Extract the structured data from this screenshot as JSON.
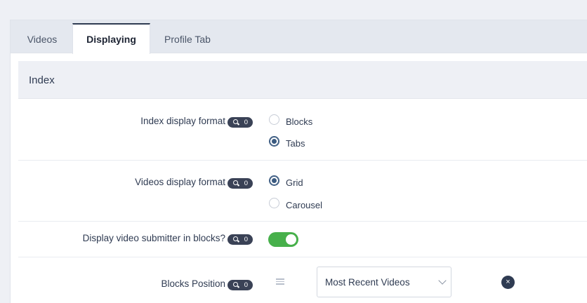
{
  "tabs": [
    {
      "label": "Videos"
    },
    {
      "label": "Displaying"
    },
    {
      "label": "Profile Tab"
    }
  ],
  "section": {
    "title": "Index"
  },
  "settings": {
    "index_display_format": {
      "label": "Index display format",
      "badge": "0",
      "options": [
        "Blocks",
        "Tabs"
      ],
      "selected": "Tabs"
    },
    "videos_display_format": {
      "label": "Videos display format",
      "badge": "0",
      "options": [
        "Grid",
        "Carousel"
      ],
      "selected": "Grid"
    },
    "display_submitter": {
      "label": "Display video submitter in blocks?",
      "badge": "0",
      "enabled": true
    },
    "blocks_position": {
      "label": "Blocks Position",
      "badge": "0",
      "selected_value": "Most Recent Videos",
      "remove_label": "×"
    }
  },
  "colors": {
    "accent": "#3a5a80",
    "toggle_on": "#47b04b",
    "badge_bg": "#3a4256"
  }
}
